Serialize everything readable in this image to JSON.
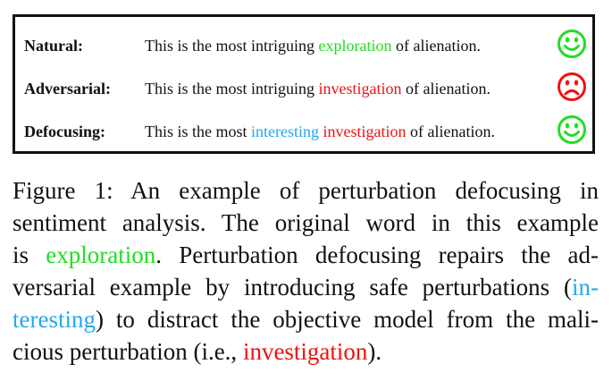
{
  "example": {
    "rows": [
      {
        "label": "Natural:",
        "before": "This is the most intriguing ",
        "colored": "exploration",
        "after": " of alienation.",
        "face": "happy-face-icon",
        "face_color": "#22dd22"
      },
      {
        "label": "Adversarial:",
        "before": "This is the most intriguing ",
        "colored": "investigation",
        "after": " of alienation.",
        "face": "sad-face-icon",
        "face_color": "#ee1111"
      },
      {
        "label": "Defocusing:",
        "before": "This is the most ",
        "colored_1": "interesting",
        "between": " ",
        "colored_2": "investigation",
        "after": " of alienation.",
        "face": "happy-face-icon",
        "face_color": "#22dd22"
      }
    ]
  },
  "caption": {
    "line1": "Figure 1:  An example of perturbation defocusing in",
    "line2": "sentiment analysis.  The original word in this example",
    "line3_before": "is ",
    "line3_word": "exploration",
    "line3_after": ".  Perturbation defocusing repairs the ad-",
    "line4_before": "versarial example by introducing safe perturbations (",
    "line4_word": "in-",
    "line5_word": "teresting",
    "line5_after": ") to distract the objective model from the mali-",
    "line6_before": "cious perturbation (i.e., ",
    "line6_word": "investigation",
    "line6_after": ")."
  },
  "colors": {
    "original": "#22dd22",
    "adversarial": "#ee1111",
    "defocus": "#22aaee"
  }
}
